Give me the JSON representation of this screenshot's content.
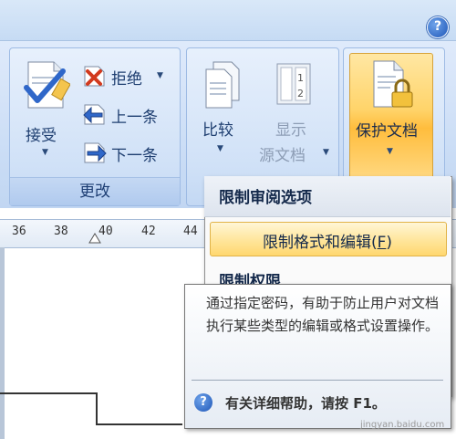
{
  "help_symbol": "?",
  "changes_group": {
    "label": "更改",
    "accept": "接受",
    "reject": "拒绝",
    "previous": "上一条",
    "next": "下一条"
  },
  "compare_group": {
    "compare": "比较",
    "show_source_line1": "显示",
    "show_source_line2": "源文档"
  },
  "protect_group": {
    "protect": "保护文档"
  },
  "ruler": [
    "36",
    "38",
    "40",
    "42",
    "44"
  ],
  "menu": {
    "title": "限制审阅选项",
    "item_label": "限制格式和编辑",
    "item_shortcut": "F",
    "next_item": "限制权限"
  },
  "tooltip": {
    "text": "通过指定密码，有助于防止用户对文档执行某些类型的编辑或格式设置操作。",
    "help": "有关详细帮助，请按 F1。"
  },
  "watermark": "jingyan.baidu.com",
  "colors": {
    "ribbon": "#c9dcf5",
    "highlight": "#ffd46a",
    "menu_text": "#14294b"
  }
}
